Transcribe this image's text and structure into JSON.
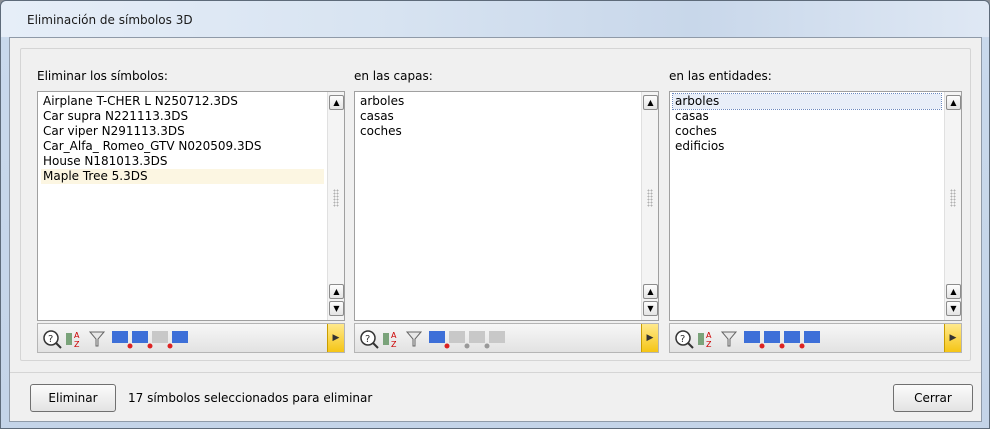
{
  "window": {
    "title": "Eliminación de símbolos 3D"
  },
  "columns": {
    "symbols": {
      "label": "Eliminar los símbolos:",
      "items": [
        "Airplane T-CHER L N250712.3DS",
        "Car supra N221113.3DS",
        "Car viper N291113.3DS",
        "Car_Alfa_ Romeo_GTV N020509.3DS",
        "House N181013.3DS",
        "Maple Tree 5.3DS"
      ]
    },
    "layers": {
      "label": "en las capas:",
      "items": [
        "arboles",
        "casas",
        "coches"
      ]
    },
    "entities": {
      "label": "en las entidades:",
      "items": [
        "arboles",
        "casas",
        "coches",
        "edificios"
      ]
    }
  },
  "footer": {
    "delete_label": "Eliminar",
    "status": "17 símbolos seleccionados para eliminar",
    "close_label": "Cerrar"
  },
  "colors": {
    "selection": "#fcf6e2",
    "toolbar_arrow": "#f5c516"
  }
}
